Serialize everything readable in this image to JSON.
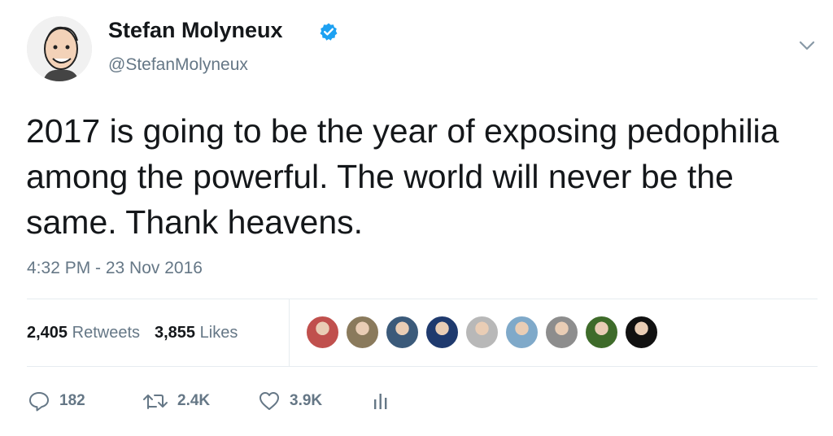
{
  "author": {
    "display_name": "Stefan Molyneux",
    "handle": "@StefanMolyneux",
    "verified": true,
    "avatar_icon": "avatar-icon"
  },
  "tweet": {
    "text": "2017 is going to be the year of exposing pedophilia among the powerful. The world will never be the same. Thank heavens.",
    "timestamp": "4:32 PM - 23 Nov 2016"
  },
  "stats": {
    "retweets_count": "2,405",
    "retweets_label": "Retweets",
    "likes_count": "3,855",
    "likes_label": "Likes"
  },
  "liker_avatars": [
    {
      "name": "liker-avatar-1",
      "color": "#c0504d"
    },
    {
      "name": "liker-avatar-2",
      "color": "#8a7a5c"
    },
    {
      "name": "liker-avatar-3",
      "color": "#3b5a7a"
    },
    {
      "name": "liker-avatar-4",
      "color": "#1f3a6e"
    },
    {
      "name": "liker-avatar-5",
      "color": "#b8b8b8"
    },
    {
      "name": "liker-avatar-6",
      "color": "#7fa9c9"
    },
    {
      "name": "liker-avatar-7",
      "color": "#8d8d8d"
    },
    {
      "name": "liker-avatar-8",
      "color": "#3e6b2a"
    },
    {
      "name": "liker-avatar-9",
      "color": "#111111"
    }
  ],
  "actions": {
    "reply_count": "182",
    "retweet_count": "2.4K",
    "like_count": "3.9K"
  },
  "colors": {
    "text": "#14171a",
    "secondary": "#657786",
    "verified_blue": "#1da1f2",
    "divider": "#e6ecf0"
  }
}
